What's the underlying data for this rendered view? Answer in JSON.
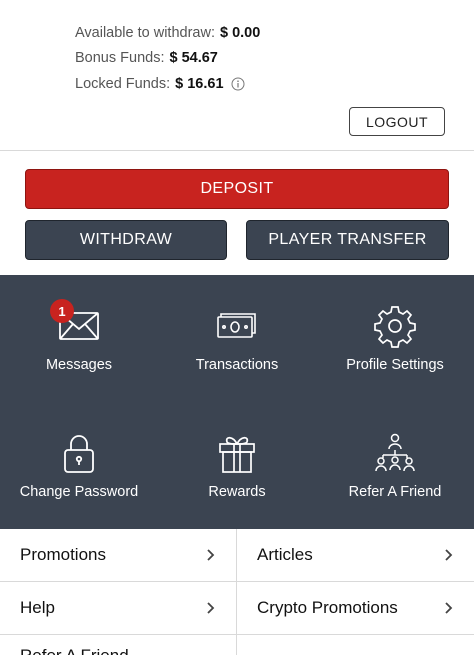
{
  "balances": {
    "withdraw_label": "Available to withdraw:",
    "withdraw_value": "$ 0.00",
    "bonus_label": "Bonus Funds:",
    "bonus_value": "$ 54.67",
    "locked_label": "Locked Funds:",
    "locked_value": "$ 16.61"
  },
  "buttons": {
    "logout": "LOGOUT",
    "deposit": "DEPOSIT",
    "withdraw": "WITHDRAW",
    "transfer": "PLAYER TRANSFER"
  },
  "menu": {
    "messages": {
      "label": "Messages",
      "badge": "1",
      "icon": "envelope-icon"
    },
    "transactions": {
      "label": "Transactions",
      "icon": "cash-icon"
    },
    "profile": {
      "label": "Profile Settings",
      "icon": "gear-icon"
    },
    "password": {
      "label": "Change Password",
      "icon": "lock-icon"
    },
    "rewards": {
      "label": "Rewards",
      "icon": "gift-icon"
    },
    "refer": {
      "label": "Refer A Friend",
      "icon": "network-icon"
    }
  },
  "links": {
    "promotions": "Promotions",
    "articles": "Articles",
    "help": "Help",
    "crypto": "Crypto Promotions",
    "partial": "Refer A Friend"
  },
  "colors": {
    "accent_red": "#c8231f",
    "panel_dark": "#3b4451"
  }
}
